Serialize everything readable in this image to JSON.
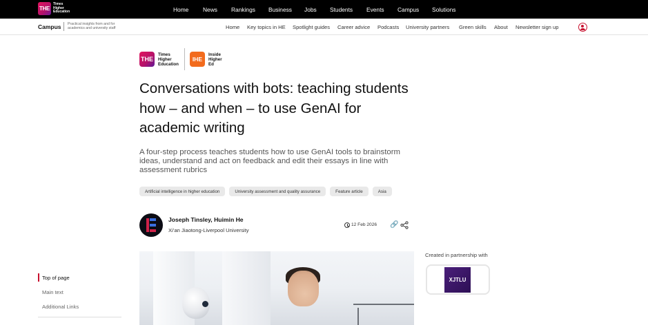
{
  "topbar": {
    "logo_mark": "THE",
    "logo_lines": [
      "Times",
      "Higher",
      "Education"
    ],
    "nav": [
      "Home",
      "News",
      "Rankings",
      "Business",
      "Jobs",
      "Students",
      "Events",
      "Campus",
      "Solutions"
    ]
  },
  "subbar": {
    "title": "Campus",
    "tagline": "Practical insights from and for academics and university staff",
    "nav": [
      "Home",
      "Key topics in HE",
      "Spotlight guides",
      "Career advice",
      "Podcasts",
      "University partners",
      "Green skills",
      "About",
      "Newsletter sign up"
    ],
    "account_icon": "user-account-icon"
  },
  "partner_logos": {
    "the_mark": "THE",
    "the_lines": [
      "Times",
      "Higher",
      "Education"
    ],
    "ihe_mark": "IHE",
    "ihe_lines": [
      "Inside",
      "Higher",
      "Ed"
    ]
  },
  "article": {
    "headline": "Conversations with bots: teaching students how – and when – to use GenAI for academic writing",
    "standfirst": "A four-step process teaches students how to use GenAI tools to brainstorm ideas, understand and act on feedback and edit their essays in line with assessment rubrics",
    "tags": [
      "Artificial intelligence in higher education",
      "University assessment and quality assurance",
      "Feature article",
      "Asia"
    ],
    "authors": "Joseph Tinsley, Huimin He",
    "institution": "Xi’an Jiaotong-Liverpool University",
    "date": "12 Feb 2026"
  },
  "sidebar": {
    "partner_label": "Created in partnership with",
    "partner_logo_text": "XJTLU"
  },
  "toc": {
    "items": [
      "Top of page",
      "Main text",
      "Additional Links"
    ],
    "active_index": 0
  },
  "colors": {
    "accent": "#c8102e",
    "brand_gradient_start": "#e2155e",
    "ihe_orange": "#f26b1d",
    "xjtlu_purple": "#4a1f7a"
  }
}
